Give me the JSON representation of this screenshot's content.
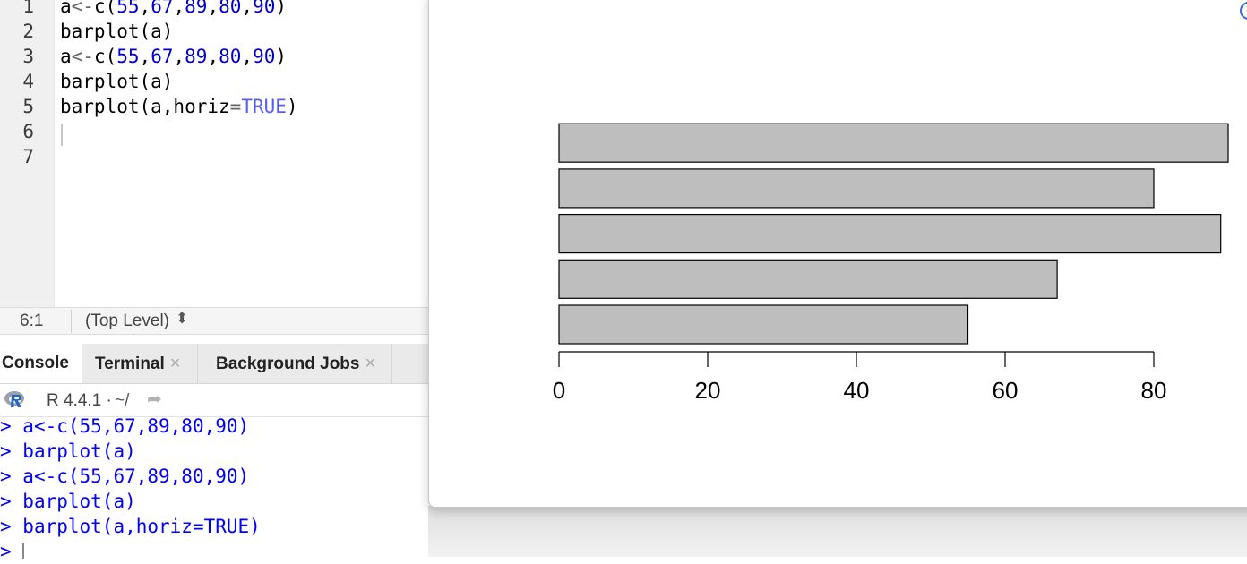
{
  "editor": {
    "line_numbers": [
      "1",
      "2",
      "3",
      "4",
      "5",
      "6",
      "7"
    ],
    "lines": [
      [
        {
          "t": "a",
          "c": ""
        },
        {
          "t": "<-",
          "c": "op"
        },
        {
          "t": "c(",
          "c": ""
        },
        {
          "t": "55",
          "c": "num"
        },
        {
          "t": ",",
          "c": ""
        },
        {
          "t": "67",
          "c": "num"
        },
        {
          "t": ",",
          "c": ""
        },
        {
          "t": "89",
          "c": "num"
        },
        {
          "t": ",",
          "c": ""
        },
        {
          "t": "80",
          "c": "num"
        },
        {
          "t": ",",
          "c": ""
        },
        {
          "t": "90",
          "c": "num"
        },
        {
          "t": ")",
          "c": ""
        }
      ],
      [
        {
          "t": "barplot(a)",
          "c": ""
        }
      ],
      [
        {
          "t": "a",
          "c": ""
        },
        {
          "t": "<-",
          "c": "op"
        },
        {
          "t": "c(",
          "c": ""
        },
        {
          "t": "55",
          "c": "num"
        },
        {
          "t": ",",
          "c": ""
        },
        {
          "t": "67",
          "c": "num"
        },
        {
          "t": ",",
          "c": ""
        },
        {
          "t": "89",
          "c": "num"
        },
        {
          "t": ",",
          "c": ""
        },
        {
          "t": "80",
          "c": "num"
        },
        {
          "t": ",",
          "c": ""
        },
        {
          "t": "90",
          "c": "num"
        },
        {
          "t": ")",
          "c": ""
        }
      ],
      [
        {
          "t": "barplot(a)",
          "c": ""
        }
      ],
      [
        {
          "t": "barplot(a,horiz",
          "c": ""
        },
        {
          "t": "=",
          "c": "op"
        },
        {
          "t": "TRUE",
          "c": "kw"
        },
        {
          "t": ")",
          "c": ""
        }
      ],
      [],
      []
    ]
  },
  "status_bar": {
    "cursor_position": "6:1",
    "scope": "(Top Level)",
    "scope_icon": "updown-chevron-icon"
  },
  "tabs": {
    "console": "Console",
    "terminal": "Terminal",
    "background_jobs": "Background Jobs",
    "close_glyph": "×"
  },
  "console": {
    "r_version": "R 4.4.1",
    "separator": "·",
    "working_dir": "~/",
    "prompt": ">",
    "history": [
      "a<-c(55,67,89,80,90)",
      "barplot(a)",
      "a<-c(55,67,89,80,90)",
      "barplot(a)",
      "barplot(a,horiz=TRUE)"
    ]
  },
  "colors": {
    "bar_fill": "#bebebe",
    "bar_stroke": "#000000",
    "number_token": "#0000cc",
    "keyword_token": "#585cf6",
    "console_command": "#0000ff"
  },
  "chart_data": {
    "type": "bar",
    "orientation": "horizontal",
    "values": [
      55,
      67,
      89,
      80,
      90
    ],
    "xticks": [
      "0",
      "20",
      "40",
      "60",
      "80"
    ],
    "xlim": [
      0,
      90
    ],
    "grid": false
  }
}
